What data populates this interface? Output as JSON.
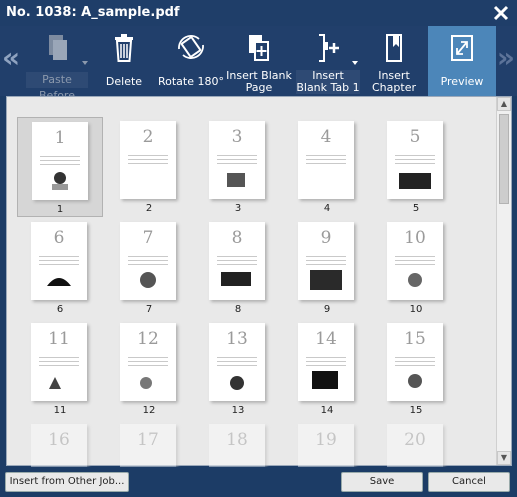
{
  "window": {
    "title": "No. 1038: A_sample.pdf"
  },
  "toolbar": {
    "paste_before": "Paste Before",
    "delete": "Delete",
    "rotate": "Rotate 180°",
    "insert_blank_page": "Insert Blank Page",
    "insert_blank_tab": "Insert Blank Tab 1",
    "insert_chapter": "Insert Chapter",
    "preview": "Preview"
  },
  "pages": [
    "1",
    "2",
    "3",
    "4",
    "5",
    "6",
    "7",
    "8",
    "9",
    "10",
    "11",
    "12",
    "13",
    "14",
    "15",
    "16",
    "17",
    "18",
    "19",
    "20"
  ],
  "selected_page": "1",
  "footer": {
    "insert_from_other": "Insert from Other Job...",
    "save": "Save",
    "cancel": "Cancel"
  }
}
